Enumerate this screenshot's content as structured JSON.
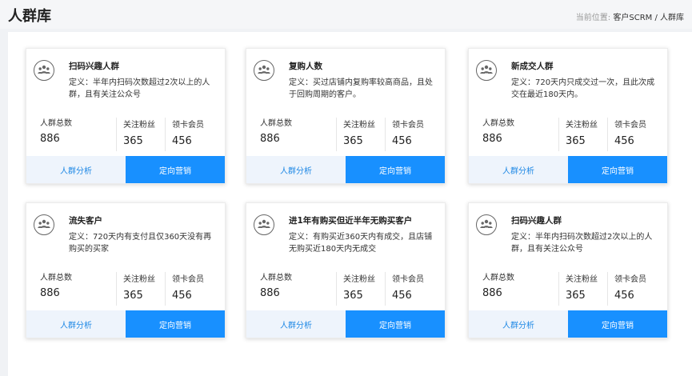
{
  "header": {
    "title": "人群库",
    "breadcrumb_prefix": "当前位置:",
    "breadcrumb_path": "客户SCRM / 人群库"
  },
  "labels": {
    "total": "人群总数",
    "fans": "关注粉丝",
    "members": "领卡会员",
    "analysis": "人群分析",
    "marketing": "定向营销"
  },
  "cards": [
    {
      "icon": "group-icon",
      "title": "扫码兴趣人群",
      "desc": "定义：半年内扫码次数超过2次以上的人群，且有关注公众号",
      "total": "886",
      "fans": "365",
      "members": "456"
    },
    {
      "icon": "group-icon",
      "title": "复购人数",
      "desc": "定义：买过店铺内复购率较高商品，且处于回购周期的客户。",
      "total": "886",
      "fans": "365",
      "members": "456"
    },
    {
      "icon": "group-icon",
      "title": "新成交人群",
      "desc": "定义：720天内只成交过一次，且此次成交在最近180天内。",
      "total": "886",
      "fans": "365",
      "members": "456"
    },
    {
      "icon": "group-icon",
      "title": "流失客户",
      "desc": "定义：720天内有支付且仅360天没有再购买的买家",
      "total": "886",
      "fans": "365",
      "members": "456"
    },
    {
      "icon": "group-icon",
      "title": "进1年有购买但近半年无购买客户",
      "desc": "定义：有购买近360天内有成交，且店铺无购买近180天内无成交",
      "total": "886",
      "fans": "365",
      "members": "456"
    },
    {
      "icon": "group-icon",
      "title": "扫码兴趣人群",
      "desc": "定义：半年内扫码次数超过2次以上的人群，且有关注公众号",
      "total": "886",
      "fans": "365",
      "members": "456"
    }
  ],
  "colors": {
    "accent": "#1890ff",
    "accent_light": "#eef4fc",
    "page_bg": "#f0f2f5"
  }
}
